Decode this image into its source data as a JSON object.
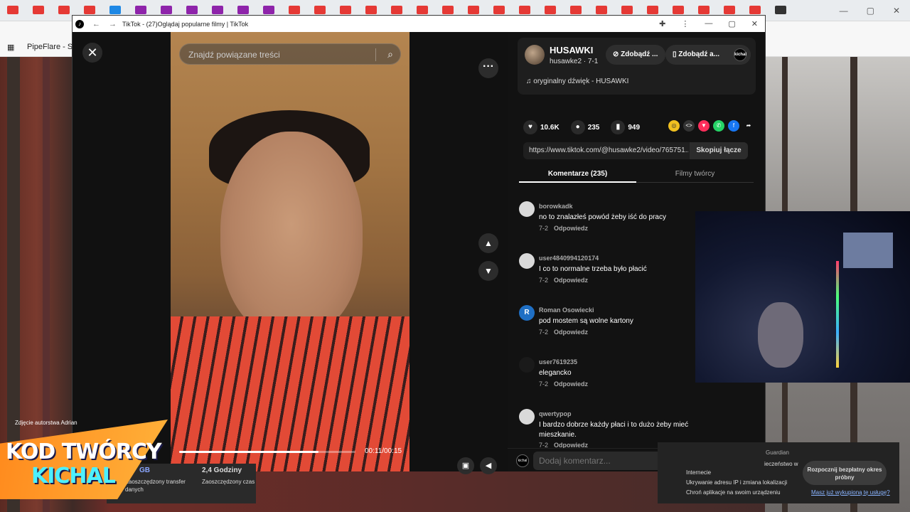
{
  "browser": {
    "bookmark": "PipeFlare - Sp"
  },
  "popup": {
    "title": "TikTok - (27)Oglądaj popularne filmy | TikTok"
  },
  "video": {
    "search_placeholder": "Znajdź powiązane treści",
    "time": "00:11/00:15",
    "progress": 0.79
  },
  "author": {
    "name": "HUSAWKI",
    "handle": "husawke2 · 7-1",
    "pill_a": "Zdobądź ...",
    "pill_b": "Zdobądź a...",
    "sound": "oryginalny dźwięk - HUSAWKI"
  },
  "stats": {
    "likes": "10.6K",
    "comments": "235",
    "saves": "949"
  },
  "link": {
    "url": "https://www.tiktok.com/@husawke2/video/765751...",
    "copy_label": "Skopiuj łącze"
  },
  "tabs": {
    "comments": "Komentarze (235)",
    "creator_videos": "Filmy twórcy"
  },
  "comments": [
    {
      "user": "borowkadk",
      "text": "no to znalazłeś powód żeby iść do pracy",
      "date": "7-2",
      "reply": "Odpowiedz",
      "avatar": "",
      "avatar_color": "#d9d9d9"
    },
    {
      "user": "user4840994120174",
      "text": "I co to normalne trzeba było płacić",
      "date": "7-2",
      "reply": "Odpowiedz",
      "avatar": "",
      "avatar_color": "#d9d9d9"
    },
    {
      "user": "Roman Osowiecki",
      "text": "pod mostem są wolne kartony",
      "date": "7-2",
      "reply": "Odpowiedz",
      "avatar": "R",
      "avatar_color": "#1f6fc4"
    },
    {
      "user": "user7619235",
      "text": "elegancko",
      "date": "7-2",
      "reply": "Odpowiedz",
      "avatar": "",
      "avatar_color": "#1a1a1a"
    },
    {
      "user": "qwertypop",
      "text": "I bardzo dobrze każdy płaci i to dużo żeby mieć mieszkanie.",
      "date": "7-2",
      "reply": "Odpowiedz",
      "avatar": "",
      "avatar_color": "#d9d9d9"
    }
  ],
  "comment_box": {
    "placeholder": "Dodaj komentarz..."
  },
  "overlay": {
    "credit": "Zdjęcie autorstwa Adrian",
    "creator_title": "KOD TWÓRCY",
    "creator_name": "KICHAL",
    "stat1_value": "GB",
    "stat1_label": "Zaoszczędzony transfer danych",
    "stat2_value": "2,4 Godziny",
    "stat2_label": "Zaoszczędzony czas"
  },
  "vpn": {
    "guardian": "Guardian",
    "security": "ieczeństwo w",
    "internet": "Internecie",
    "line1": "Ukrywanie adresu IP i zmiana lokalizacji",
    "line2": "Chroń aplikacje na swoim urządzeniu",
    "cta": "Rozpocznij bezpłatny okres próbny",
    "link": "Masz już wykupioną tę usługę?"
  }
}
